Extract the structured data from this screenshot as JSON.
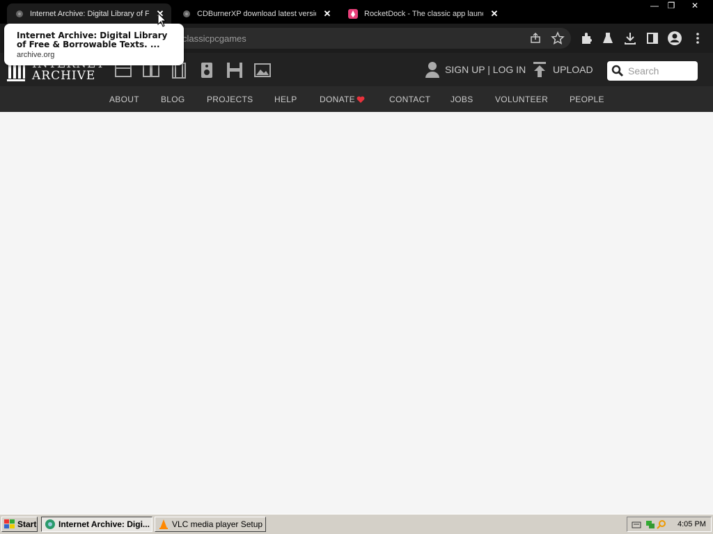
{
  "browser": {
    "tabs": [
      {
        "title": "Internet Archive: Digital Library of F",
        "active": true
      },
      {
        "title": "CDBurnerXP download latest version",
        "active": false
      },
      {
        "title": "RocketDock - The classic app launch",
        "active": false
      }
    ],
    "address_bar": "classicpcgames",
    "tooltip": {
      "title": "Internet Archive: Digital Library of Free & Borrowable Texts. ...",
      "domain": "archive.org"
    },
    "icons": [
      "share-icon",
      "star-icon",
      "extensions-icon",
      "labs-icon",
      "download-icon",
      "sidepanel-icon",
      "profile-icon",
      "menu-icon"
    ]
  },
  "archive": {
    "logo_line1": "INTERNET",
    "logo_line2": "ARCHIVE",
    "media_icons": [
      "web-icon",
      "texts-icon",
      "video-icon",
      "audio-icon",
      "software-icon",
      "images-icon"
    ],
    "signup_label": "SIGN UP | LOG IN",
    "upload_label": "UPLOAD",
    "search_placeholder": "Search",
    "nav": [
      "ABOUT",
      "BLOG",
      "PROJECTS",
      "HELP",
      "DONATE",
      "CONTACT",
      "JOBS",
      "VOLUNTEER",
      "PEOPLE"
    ]
  },
  "taskbar": {
    "start_label": "Start",
    "tasks": [
      "Internet Archive: Digi...",
      "VLC media player Setup"
    ],
    "clock": "4:05 PM"
  },
  "colors": {
    "donate_heart": "#e8323c",
    "ia_dark": "#222222",
    "tab_bg": "#000000"
  }
}
